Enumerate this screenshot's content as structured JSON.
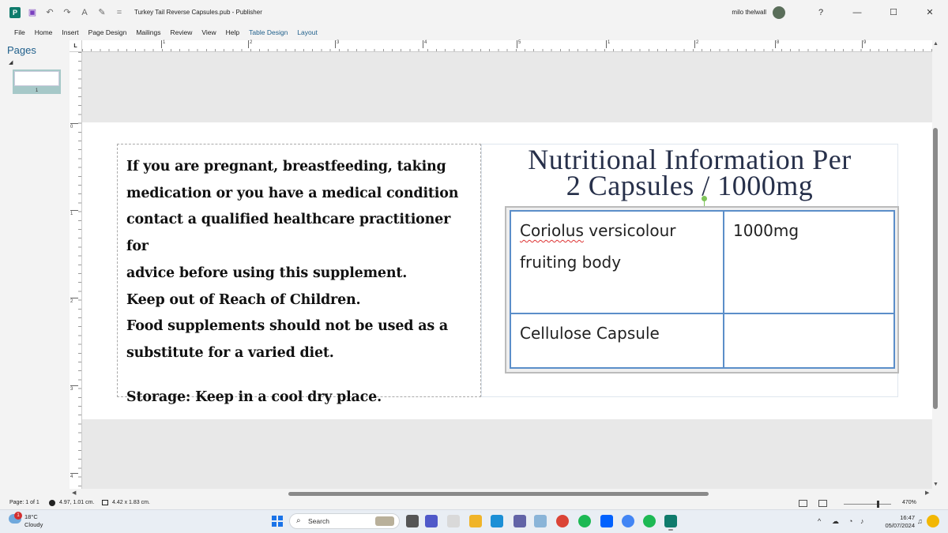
{
  "window": {
    "title": "Turkey Tail Reverse Capsules.pub  -  Publisher",
    "user_name": "milo thelwall",
    "help_label": "?",
    "minimize_label": "—",
    "maximize_label": "☐",
    "close_label": "✕"
  },
  "quick_access": {
    "undo_label": "↶",
    "redo_label": "↷",
    "format_label": "A",
    "customize_label": "="
  },
  "menu": {
    "tabs": [
      "File",
      "Home",
      "Insert",
      "Page Design",
      "Mailings",
      "Review",
      "View",
      "Help",
      "Table Design",
      "Layout"
    ]
  },
  "pages_pane": {
    "title": "Pages",
    "page_number": "1"
  },
  "rulers": {
    "corner_label": "L",
    "h_ticks": [
      "1",
      "2",
      "3",
      "4",
      "5",
      "1",
      "2",
      "8",
      "9"
    ],
    "v_ticks": [
      "0",
      "1",
      "2",
      "3",
      "4"
    ]
  },
  "document": {
    "warning_text": "If you are pregnant, breastfeeding, taking\nmedication or you have a medical condition\ncontact a qualified healthcare practitioner for\nadvice before using this supplement.\nKeep out of Reach of Children.\nFood supplements should not be used as a\nsubstitute for a varied diet.",
    "storage_text": "Storage: Keep in a cool dry place.",
    "nutrition_title_line1": "Nutritional Information Per",
    "nutrition_title_line2": "2 Capsules / 1000mg",
    "table": {
      "row1_col1_word1": "Coriolus",
      "row1_col1_rest": " versicolour",
      "row1_col1_line2": "fruiting body",
      "row1_col2": "1000mg",
      "row2_col1": "Cellulose Capsule",
      "row2_col2": ""
    }
  },
  "status_bar": {
    "page": "Page: 1 of 1",
    "position": "4.97, 1.01 cm.",
    "size": "4.42 x  1.83 cm.",
    "zoom": "470%"
  },
  "taskbar": {
    "weather_temp": "18°C",
    "weather_desc": "Cloudy",
    "weather_badge": "1",
    "search_placeholder": "Search",
    "time": "16:47",
    "date": "05/07/2024",
    "teams_badge": "11"
  },
  "colors": {
    "accent": "#1f5f8b",
    "table_border": "#5b8ec9",
    "title_text": "#27304a",
    "publisher_icon": "#0f7b6c"
  }
}
